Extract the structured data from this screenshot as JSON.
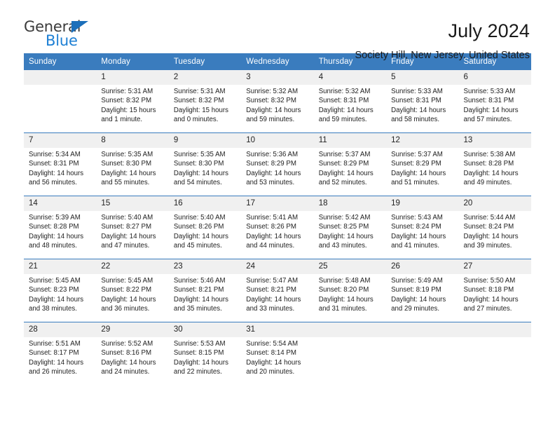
{
  "brand": {
    "name_top": "General",
    "name_bottom": "Blue",
    "accent_color": "#1c7fd4",
    "triangle_color": "#1c6fba"
  },
  "header": {
    "title": "July 2024",
    "subtitle": "Society Hill, New Jersey, United States"
  },
  "theme": {
    "header_row_bg": "#3a7cbe",
    "daynum_bg": "#f0f0f0",
    "text_color": "#222222"
  },
  "weekdays": [
    "Sunday",
    "Monday",
    "Tuesday",
    "Wednesday",
    "Thursday",
    "Friday",
    "Saturday"
  ],
  "weeks": [
    [
      {
        "day": "",
        "l1": "",
        "l2": "",
        "l3": "",
        "l4": ""
      },
      {
        "day": "1",
        "l1": "Sunrise: 5:31 AM",
        "l2": "Sunset: 8:32 PM",
        "l3": "Daylight: 15 hours",
        "l4": "and 1 minute."
      },
      {
        "day": "2",
        "l1": "Sunrise: 5:31 AM",
        "l2": "Sunset: 8:32 PM",
        "l3": "Daylight: 15 hours",
        "l4": "and 0 minutes."
      },
      {
        "day": "3",
        "l1": "Sunrise: 5:32 AM",
        "l2": "Sunset: 8:32 PM",
        "l3": "Daylight: 14 hours",
        "l4": "and 59 minutes."
      },
      {
        "day": "4",
        "l1": "Sunrise: 5:32 AM",
        "l2": "Sunset: 8:31 PM",
        "l3": "Daylight: 14 hours",
        "l4": "and 59 minutes."
      },
      {
        "day": "5",
        "l1": "Sunrise: 5:33 AM",
        "l2": "Sunset: 8:31 PM",
        "l3": "Daylight: 14 hours",
        "l4": "and 58 minutes."
      },
      {
        "day": "6",
        "l1": "Sunrise: 5:33 AM",
        "l2": "Sunset: 8:31 PM",
        "l3": "Daylight: 14 hours",
        "l4": "and 57 minutes."
      }
    ],
    [
      {
        "day": "7",
        "l1": "Sunrise: 5:34 AM",
        "l2": "Sunset: 8:31 PM",
        "l3": "Daylight: 14 hours",
        "l4": "and 56 minutes."
      },
      {
        "day": "8",
        "l1": "Sunrise: 5:35 AM",
        "l2": "Sunset: 8:30 PM",
        "l3": "Daylight: 14 hours",
        "l4": "and 55 minutes."
      },
      {
        "day": "9",
        "l1": "Sunrise: 5:35 AM",
        "l2": "Sunset: 8:30 PM",
        "l3": "Daylight: 14 hours",
        "l4": "and 54 minutes."
      },
      {
        "day": "10",
        "l1": "Sunrise: 5:36 AM",
        "l2": "Sunset: 8:29 PM",
        "l3": "Daylight: 14 hours",
        "l4": "and 53 minutes."
      },
      {
        "day": "11",
        "l1": "Sunrise: 5:37 AM",
        "l2": "Sunset: 8:29 PM",
        "l3": "Daylight: 14 hours",
        "l4": "and 52 minutes."
      },
      {
        "day": "12",
        "l1": "Sunrise: 5:37 AM",
        "l2": "Sunset: 8:29 PM",
        "l3": "Daylight: 14 hours",
        "l4": "and 51 minutes."
      },
      {
        "day": "13",
        "l1": "Sunrise: 5:38 AM",
        "l2": "Sunset: 8:28 PM",
        "l3": "Daylight: 14 hours",
        "l4": "and 49 minutes."
      }
    ],
    [
      {
        "day": "14",
        "l1": "Sunrise: 5:39 AM",
        "l2": "Sunset: 8:28 PM",
        "l3": "Daylight: 14 hours",
        "l4": "and 48 minutes."
      },
      {
        "day": "15",
        "l1": "Sunrise: 5:40 AM",
        "l2": "Sunset: 8:27 PM",
        "l3": "Daylight: 14 hours",
        "l4": "and 47 minutes."
      },
      {
        "day": "16",
        "l1": "Sunrise: 5:40 AM",
        "l2": "Sunset: 8:26 PM",
        "l3": "Daylight: 14 hours",
        "l4": "and 45 minutes."
      },
      {
        "day": "17",
        "l1": "Sunrise: 5:41 AM",
        "l2": "Sunset: 8:26 PM",
        "l3": "Daylight: 14 hours",
        "l4": "and 44 minutes."
      },
      {
        "day": "18",
        "l1": "Sunrise: 5:42 AM",
        "l2": "Sunset: 8:25 PM",
        "l3": "Daylight: 14 hours",
        "l4": "and 43 minutes."
      },
      {
        "day": "19",
        "l1": "Sunrise: 5:43 AM",
        "l2": "Sunset: 8:24 PM",
        "l3": "Daylight: 14 hours",
        "l4": "and 41 minutes."
      },
      {
        "day": "20",
        "l1": "Sunrise: 5:44 AM",
        "l2": "Sunset: 8:24 PM",
        "l3": "Daylight: 14 hours",
        "l4": "and 39 minutes."
      }
    ],
    [
      {
        "day": "21",
        "l1": "Sunrise: 5:45 AM",
        "l2": "Sunset: 8:23 PM",
        "l3": "Daylight: 14 hours",
        "l4": "and 38 minutes."
      },
      {
        "day": "22",
        "l1": "Sunrise: 5:45 AM",
        "l2": "Sunset: 8:22 PM",
        "l3": "Daylight: 14 hours",
        "l4": "and 36 minutes."
      },
      {
        "day": "23",
        "l1": "Sunrise: 5:46 AM",
        "l2": "Sunset: 8:21 PM",
        "l3": "Daylight: 14 hours",
        "l4": "and 35 minutes."
      },
      {
        "day": "24",
        "l1": "Sunrise: 5:47 AM",
        "l2": "Sunset: 8:21 PM",
        "l3": "Daylight: 14 hours",
        "l4": "and 33 minutes."
      },
      {
        "day": "25",
        "l1": "Sunrise: 5:48 AM",
        "l2": "Sunset: 8:20 PM",
        "l3": "Daylight: 14 hours",
        "l4": "and 31 minutes."
      },
      {
        "day": "26",
        "l1": "Sunrise: 5:49 AM",
        "l2": "Sunset: 8:19 PM",
        "l3": "Daylight: 14 hours",
        "l4": "and 29 minutes."
      },
      {
        "day": "27",
        "l1": "Sunrise: 5:50 AM",
        "l2": "Sunset: 8:18 PM",
        "l3": "Daylight: 14 hours",
        "l4": "and 27 minutes."
      }
    ],
    [
      {
        "day": "28",
        "l1": "Sunrise: 5:51 AM",
        "l2": "Sunset: 8:17 PM",
        "l3": "Daylight: 14 hours",
        "l4": "and 26 minutes."
      },
      {
        "day": "29",
        "l1": "Sunrise: 5:52 AM",
        "l2": "Sunset: 8:16 PM",
        "l3": "Daylight: 14 hours",
        "l4": "and 24 minutes."
      },
      {
        "day": "30",
        "l1": "Sunrise: 5:53 AM",
        "l2": "Sunset: 8:15 PM",
        "l3": "Daylight: 14 hours",
        "l4": "and 22 minutes."
      },
      {
        "day": "31",
        "l1": "Sunrise: 5:54 AM",
        "l2": "Sunset: 8:14 PM",
        "l3": "Daylight: 14 hours",
        "l4": "and 20 minutes."
      },
      {
        "day": "",
        "l1": "",
        "l2": "",
        "l3": "",
        "l4": ""
      },
      {
        "day": "",
        "l1": "",
        "l2": "",
        "l3": "",
        "l4": ""
      },
      {
        "day": "",
        "l1": "",
        "l2": "",
        "l3": "",
        "l4": ""
      }
    ]
  ]
}
